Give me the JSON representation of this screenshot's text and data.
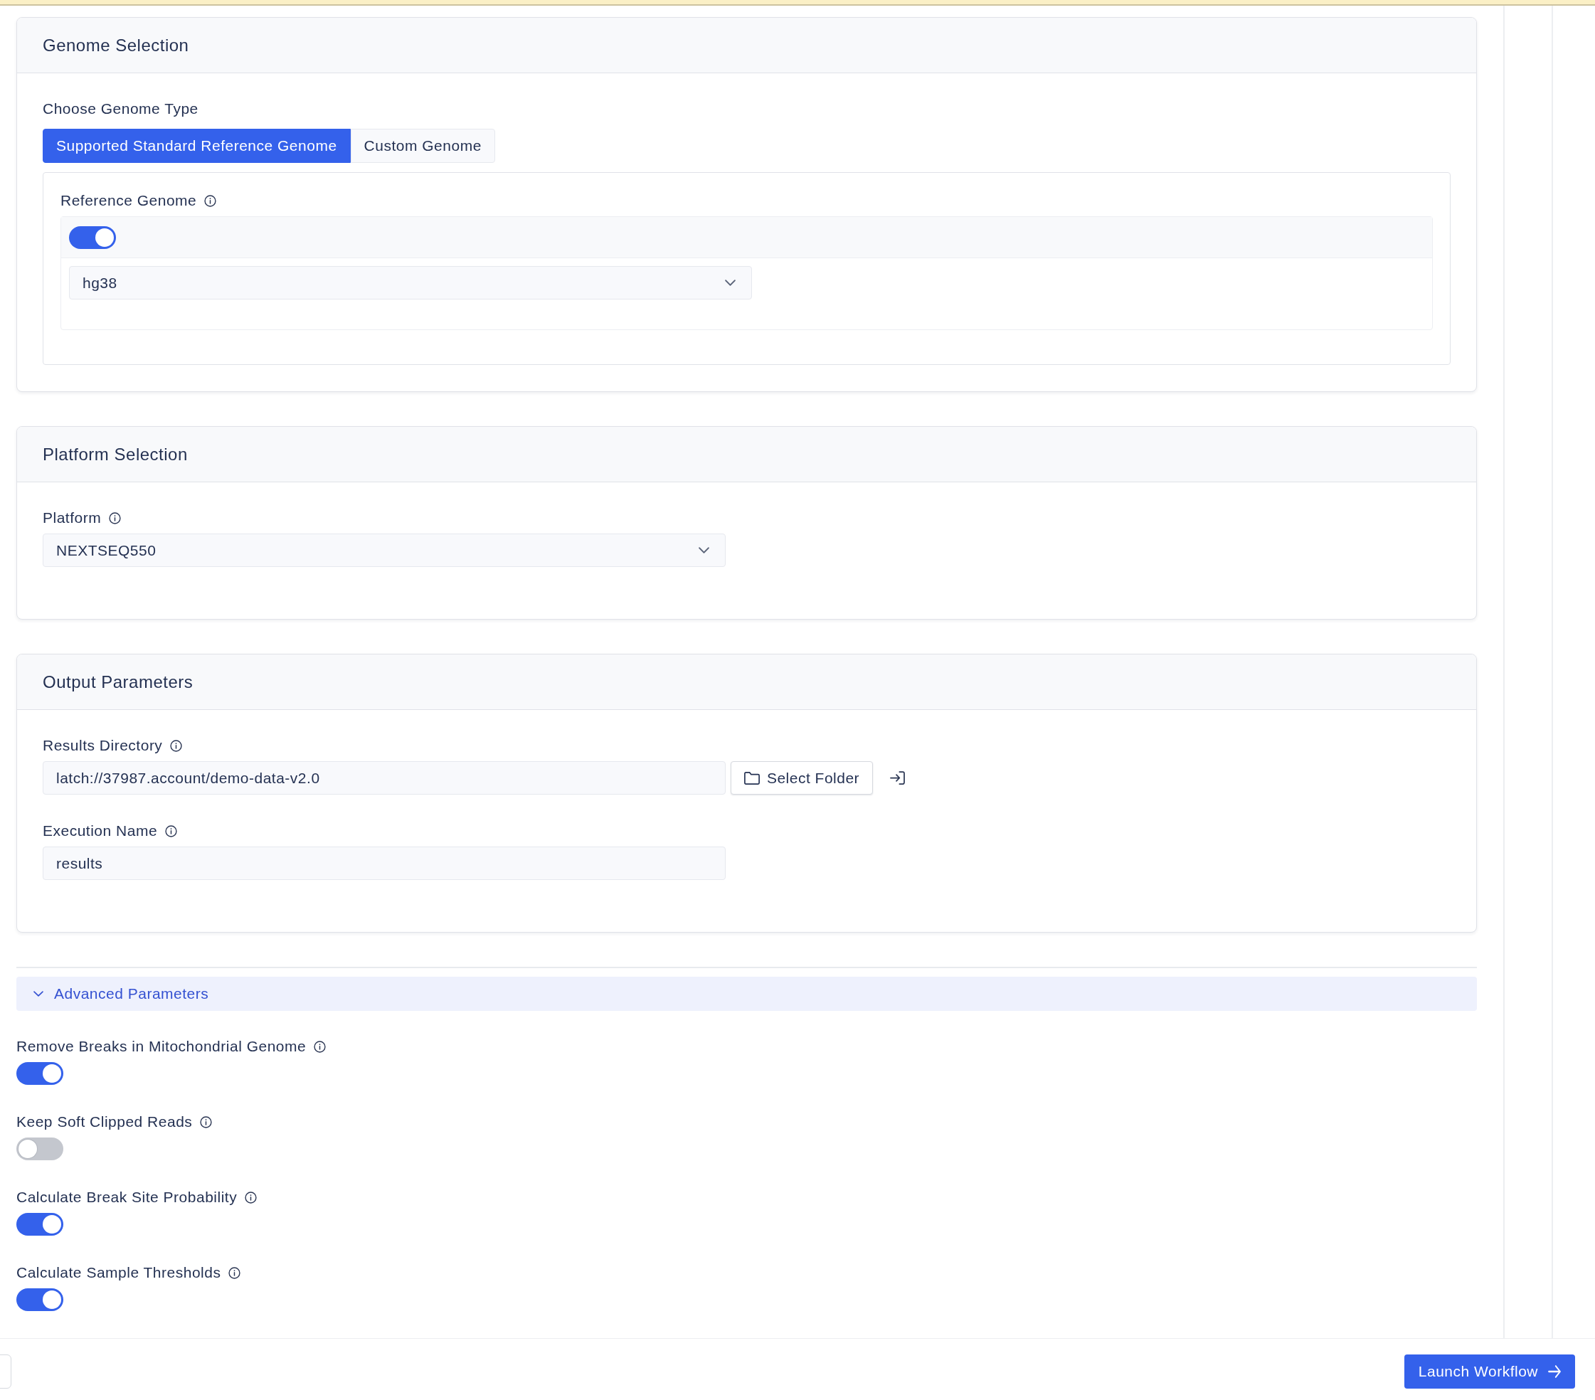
{
  "sections": [
    {
      "kind": "tabbed",
      "title": "Genome Selection",
      "tabs_label": "Choose Genome Type",
      "tabs": [
        {
          "label": "Supported Standard Reference Genome",
          "selected": true
        },
        {
          "label": "Custom Genome",
          "selected": false
        }
      ],
      "fields": [
        {
          "kind": "toggle_select",
          "label": "Reference Genome",
          "on": true,
          "value": "hg38"
        }
      ]
    },
    {
      "kind": "plain",
      "title": "Platform Selection",
      "fields": [
        {
          "kind": "select",
          "label": "Platform",
          "value": "NEXTSEQ550"
        }
      ]
    },
    {
      "kind": "plain",
      "title": "Output Parameters",
      "fields": [
        {
          "kind": "path",
          "label": "Results Directory",
          "value": "latch://37987.account/demo-data-v2.0",
          "button": "Select Folder"
        },
        {
          "kind": "text",
          "label": "Execution Name",
          "value": "results"
        }
      ]
    }
  ],
  "advanced": {
    "title": "Advanced Parameters",
    "expanded": true,
    "toggles": [
      {
        "label": "Remove Breaks in Mitochondrial Genome",
        "on": true
      },
      {
        "label": "Keep Soft Clipped Reads",
        "on": false
      },
      {
        "label": "Calculate Break Site Probability",
        "on": true
      },
      {
        "label": "Calculate Sample Thresholds",
        "on": true
      }
    ]
  },
  "footer": {
    "launch_button": "Launch Workflow"
  }
}
